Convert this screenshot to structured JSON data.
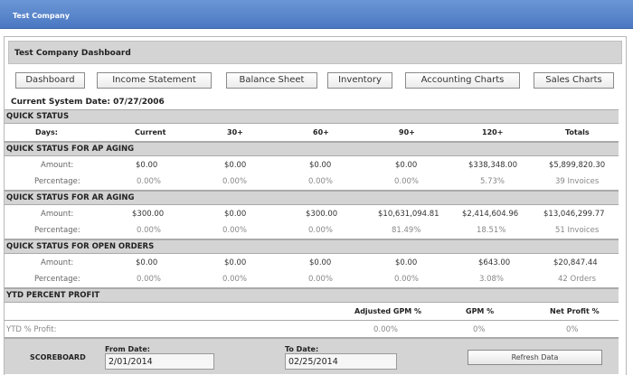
{
  "app": {
    "title": "Test Company"
  },
  "dashboard": {
    "title": "Test Company Dashboard"
  },
  "nav": {
    "dashboard": "Dashboard",
    "income_statement": "Income Statement",
    "balance_sheet": "Balance Sheet",
    "inventory": "Inventory",
    "accounting_charts": "Accounting Charts",
    "sales_charts": "Sales Charts"
  },
  "system_date": "Current System Date: 07/27/2006",
  "quick_status": {
    "title": "QUICK STATUS",
    "columns": [
      "Days:",
      "Current",
      "30+",
      "60+",
      "90+",
      "120+",
      "Totals"
    ]
  },
  "ap": {
    "title": "QUICK STATUS FOR AP AGING",
    "amount_label": "Amount:",
    "percentage_label": "Percentage:",
    "amounts": [
      "$0.00",
      "$0.00",
      "$0.00",
      "$0.00",
      "$338,348.00",
      "$5,899,820.30"
    ],
    "percentages": [
      "0.00%",
      "0.00%",
      "0.00%",
      "0.00%",
      "5.73%",
      "39 Invoices"
    ]
  },
  "ar": {
    "title": "QUICK STATUS FOR AR AGING",
    "amount_label": "Amount:",
    "percentage_label": "Percentage:",
    "amounts": [
      "$300.00",
      "$0.00",
      "$300.00",
      "$10,631,094.81",
      "$2,414,604.96",
      "$13,046,299.77"
    ],
    "percentages": [
      "0.00%",
      "0.00%",
      "0.00%",
      "81.49%",
      "18.51%",
      "51 Invoices"
    ]
  },
  "orders": {
    "title": "QUICK STATUS FOR OPEN ORDERS",
    "amount_label": "Amount:",
    "percentage_label": "Percentage:",
    "amounts": [
      "$0.00",
      "$0.00",
      "$0.00",
      "$0.00",
      "$643.00",
      "$20,847.44"
    ],
    "percentages": [
      "0.00%",
      "0.00%",
      "0.00%",
      "0.00%",
      "3.08%",
      "42 Orders"
    ]
  },
  "ytd": {
    "title": "YTD PERCENT PROFIT",
    "columns": [
      "Adjusted GPM %",
      "GPM %",
      "Net Profit %"
    ],
    "label": "YTD % Profit:",
    "values": [
      "0.00%",
      "0%",
      "0%"
    ]
  },
  "scoreboard": {
    "title": "SCOREBOARD",
    "from_label": "From Date:",
    "from_value": "2/01/2014",
    "to_label": "To Date:",
    "to_value": "02/25/2014",
    "refresh": "Refresh Data"
  }
}
